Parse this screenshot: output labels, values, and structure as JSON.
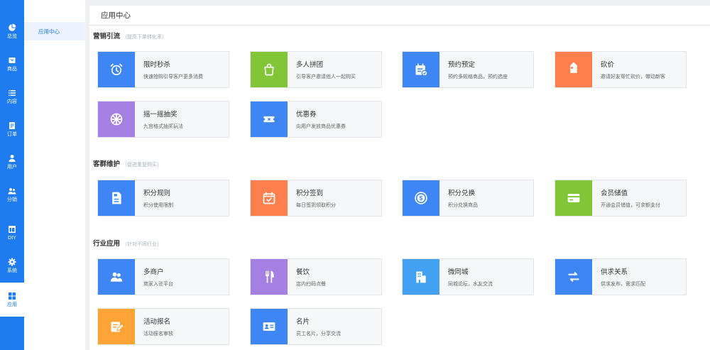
{
  "colors": {
    "rail": "#1e7cf0",
    "blue": "#3f86f5",
    "green": "#80c637",
    "orange": "#fc7f4d",
    "purple": "#a57fe1",
    "amber": "#fea335",
    "sky": "#43a1f3"
  },
  "sidebar": {
    "items": [
      {
        "label": "总览",
        "icon": "pie-chart-icon"
      },
      {
        "label": "商品",
        "icon": "product-icon"
      },
      {
        "label": "内容",
        "icon": "list-icon"
      },
      {
        "label": "订单",
        "icon": "order-icon"
      },
      {
        "label": "用户",
        "icon": "user-icon"
      },
      {
        "label": "分销",
        "icon": "group-icon"
      },
      {
        "label": "DIY",
        "icon": "layout-icon"
      },
      {
        "label": "系统",
        "icon": "gear-icon"
      },
      {
        "label": "应用",
        "icon": "apps-grid-icon"
      }
    ]
  },
  "subnav": {
    "active": "应用中心"
  },
  "header": {
    "title": "应用中心"
  },
  "sections": [
    {
      "title": "营销引流",
      "hint": "（提高下单转化率）",
      "cards": [
        {
          "title": "限时秒杀",
          "desc": "快速抢购引导客户更多消费",
          "color": "#3f86f5",
          "icon": "alarm-clock-icon"
        },
        {
          "title": "多人拼团",
          "desc": "引导客户邀请他人一起购买",
          "color": "#80c637",
          "icon": "shopping-bag-icon"
        },
        {
          "title": "预约预定",
          "desc": "预约多规格商品，预约选座",
          "color": "#3f86f5",
          "icon": "calendar-check-icon"
        },
        {
          "title": "砍价",
          "desc": "邀请好友帮忙砍价，带动新客",
          "color": "#fc7f4d",
          "icon": "price-tag-icon"
        },
        {
          "title": "摇一摇抽奖",
          "desc": "九宫格式抽奖玩法",
          "color": "#a57fe1",
          "icon": "prize-wheel-icon"
        },
        {
          "title": "优惠券",
          "desc": "向用户发放商品优惠券",
          "color": "#3f86f5",
          "icon": "coupon-icon"
        }
      ]
    },
    {
      "title": "客群维护",
      "hint": "（促进重复购买）",
      "cards": [
        {
          "title": "积分规则",
          "desc": "积分使用限制",
          "color": "#3f86f5",
          "icon": "document-icon"
        },
        {
          "title": "积分签到",
          "desc": "每日签到领取积分",
          "color": "#fc7f4d",
          "icon": "calendar-checkin-icon"
        },
        {
          "title": "积分兑换",
          "desc": "积分兑换商品",
          "color": "#3f86f5",
          "icon": "dollar-coin-icon"
        },
        {
          "title": "会员储值",
          "desc": "开通会员储值，可余额支付",
          "color": "#80c637",
          "icon": "credit-card-icon"
        }
      ]
    },
    {
      "title": "行业应用",
      "hint": "（针对不同行业）",
      "cards": [
        {
          "title": "多商户",
          "desc": "商家入驻平台",
          "color": "#3f86f5",
          "icon": "merchants-icon"
        },
        {
          "title": "餐饮",
          "desc": "店内扫码点餐",
          "color": "#a57fe1",
          "icon": "fork-knife-icon"
        },
        {
          "title": "微同城",
          "desc": "同城论坛，水友交流",
          "color": "#43a1f3",
          "icon": "building-icon"
        },
        {
          "title": "供求关系",
          "desc": "供求发布，需求匹配",
          "color": "#3f86f5",
          "icon": "exchange-arrows-icon"
        },
        {
          "title": "活动报名",
          "desc": "活动报名审核",
          "color": "#fea335",
          "icon": "edit-form-icon"
        },
        {
          "title": "名片",
          "desc": "员工名片，分享交流",
          "color": "#3f86f5",
          "icon": "business-card-icon"
        }
      ]
    }
  ]
}
